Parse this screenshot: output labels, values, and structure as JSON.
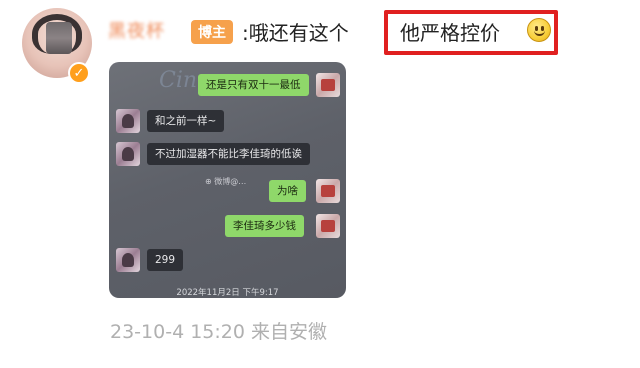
{
  "post": {
    "username": "黑夜杯",
    "role_tag": "博主",
    "comment_prefix": ":哦还有这个",
    "highlight_text": "他严格控价",
    "meta": "23-10-4 15:20 来自安徽"
  },
  "icons": {
    "avatar": "user-avatar-pixelated",
    "verified": "verified-v-badge",
    "emoji": "smile-emoji-icon"
  },
  "chat_screenshot": {
    "watermark_word": "Cin",
    "center_watermark": "⊕ 微博@…",
    "timestamp": "2022年11月2日 下午9:17",
    "messages": [
      {
        "side": "out",
        "text": "还是只有双十一最低"
      },
      {
        "side": "in",
        "text": "和之前一样~"
      },
      {
        "side": "in",
        "text": "不过加湿器不能比李佳琦的低诶"
      },
      {
        "side": "out",
        "text": "为啥"
      },
      {
        "side": "out",
        "text": "李佳琦多少钱"
      },
      {
        "side": "in",
        "text": "299"
      }
    ]
  },
  "colors": {
    "highlight_border": "#e02020",
    "role_tag_bg": "#f6a14c",
    "username": "#ef8a58",
    "out_bubble": "#8fd86a",
    "in_bubble": "#2e3036",
    "meta_text": "#b0b0b0"
  }
}
